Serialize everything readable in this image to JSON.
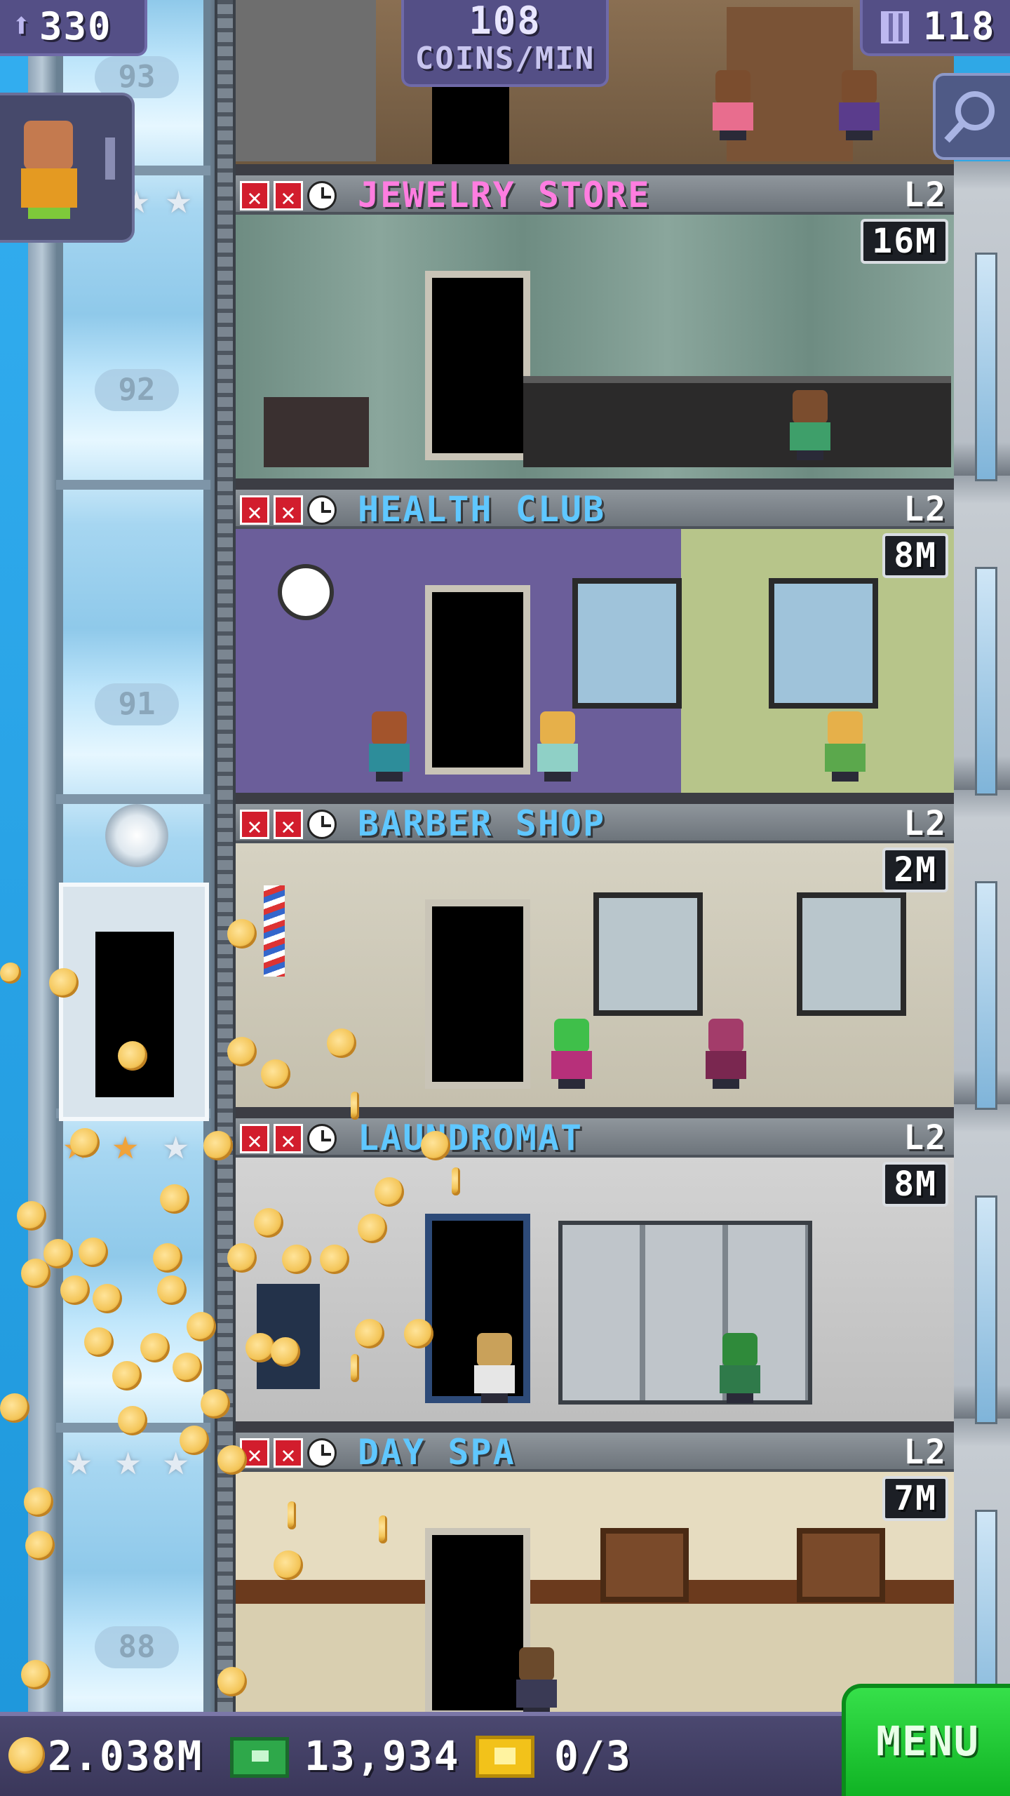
{
  "hud": {
    "population": "330",
    "coins_per_min_value": "108",
    "coins_per_min_label": "COINS/MIN",
    "floors": "118"
  },
  "shaft": {
    "floor_numbers": [
      "93",
      "92",
      "91",
      "88"
    ]
  },
  "floors": [
    {
      "name": "JEWELRY STORE",
      "level": "L2",
      "price": "16M",
      "name_color": "#ff7de0"
    },
    {
      "name": "HEALTH CLUB",
      "level": "L2",
      "price": "8M",
      "name_color": "#5fc7ff"
    },
    {
      "name": "BARBER SHOP",
      "level": "L2",
      "price": "2M",
      "name_color": "#5fc7ff"
    },
    {
      "name": "LAUNDROMAT",
      "level": "L2",
      "price": "8M",
      "name_color": "#5fc7ff"
    },
    {
      "name": "DAY SPA",
      "level": "L2",
      "price": "7M",
      "name_color": "#5fc7ff"
    }
  ],
  "bottom": {
    "coins": "2.038M",
    "bux": "13,934",
    "tickets": "0/3",
    "menu_label": "MENU"
  },
  "colors": {
    "menu_green": "#22c934",
    "hud_purple": "#544f86",
    "stock_red": "#d21d2d"
  }
}
